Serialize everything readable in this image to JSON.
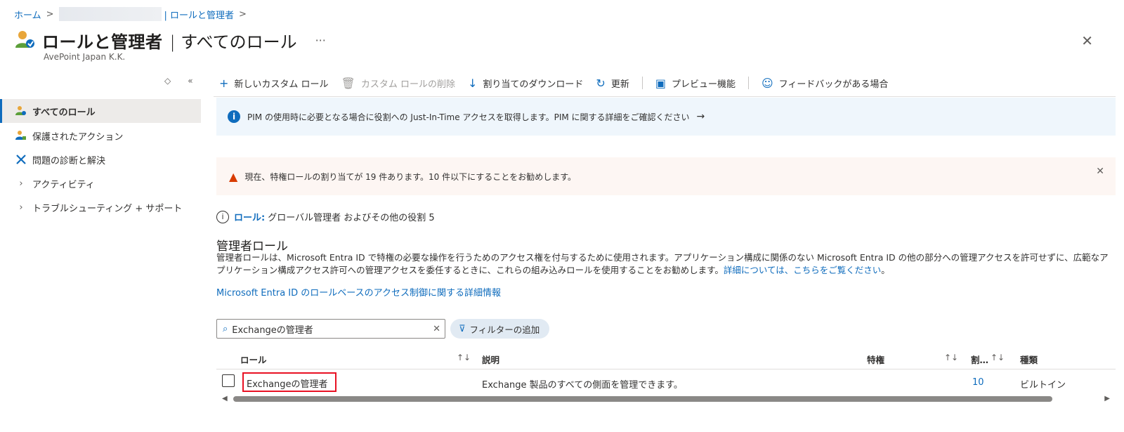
{
  "breadcrumb": {
    "home": "ホーム",
    "separator": ">",
    "current": "| ロールと管理者",
    "trailing": ">"
  },
  "header": {
    "title": "ロールと管理者",
    "subtitle": "| すべてのロール",
    "more": "···",
    "org": "AvePoint Japan K.K.",
    "close": "✕"
  },
  "sidebar": {
    "collapse_icons": [
      "◇",
      "«"
    ],
    "items": [
      {
        "label": "すべてのロール",
        "icon": "roles-icon",
        "active": true
      },
      {
        "label": "保護されたアクション",
        "icon": "protected-actions-icon"
      },
      {
        "label": "問題の診断と解決",
        "icon": "tools-icon"
      },
      {
        "label": "アクティビティ",
        "icon": "chevron-right-icon"
      },
      {
        "label": "トラブルシューティング + サポート",
        "icon": "chevron-right-icon"
      }
    ]
  },
  "toolbar": {
    "new_role": "新しいカスタム ロール",
    "delete_role": "カスタム ロールの削除",
    "download": "割り当てのダウンロード",
    "refresh": "更新",
    "preview": "プレビュー機能",
    "feedback": "フィードバックがある場合"
  },
  "info_bar": {
    "text": "PIM の使用時に必要となる場合に役割への Just-In-Time アクセスを取得します。PIM に関する詳細をご確認ください",
    "arrow": "→"
  },
  "warn_bar": {
    "text": "現在、特権ロールの割り当てが 19 件あります。10 件以下にすることをお勧めします。",
    "close": "✕"
  },
  "role_line": {
    "label": "ロール:",
    "text": "グローバル管理者 およびその他の役割 5"
  },
  "section": {
    "title": "管理者ロール",
    "desc": "管理者ロールは、Microsoft Entra ID で特権の必要な操作を行うためのアクセス権を付与するために使用されます。アプリケーション構成に関係のない Microsoft Entra ID の他の部分への管理アクセスを許可せずに、広範なアプリケーション構成アクセス許可への管理アクセスを委任するときに、これらの組み込みロールを使用することをお勧めします。",
    "desc_link": "詳細については、こちらをご覧ください",
    "desc_end": "。",
    "learn_more": "Microsoft Entra ID のロールベースのアクセス制御に関する詳細情報"
  },
  "search": {
    "value": "Exchangeの管理者",
    "clear": "✕"
  },
  "filter": {
    "label": "フィルターの追加"
  },
  "table": {
    "headers": {
      "role": "ロール",
      "desc": "説明",
      "privilege": "特権",
      "assign": "割…",
      "type": "種類"
    },
    "sort_icon": "↑↓",
    "rows": [
      {
        "role": "Exchangeの管理者",
        "desc": "Exchange 製品のすべての側面を管理できます。",
        "privilege": "",
        "assign": "10",
        "type": "ビルトイン"
      }
    ]
  },
  "colors": {
    "accent": "#0f6cbd",
    "warning": "#d83b01",
    "highlight_border": "#e81123"
  }
}
